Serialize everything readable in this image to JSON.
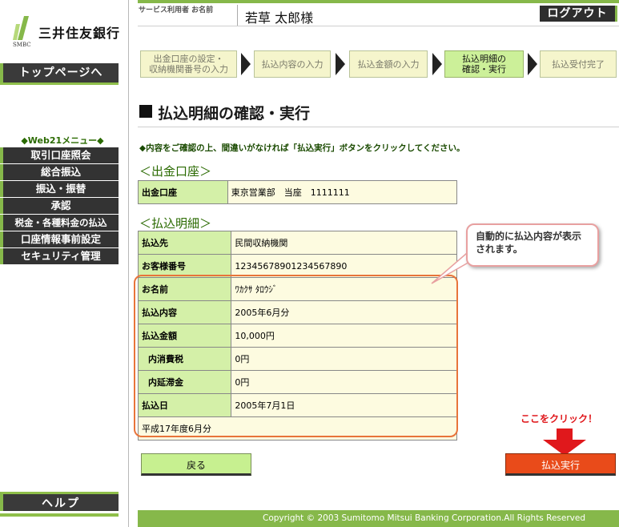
{
  "brand": {
    "name": "三井住友銀行",
    "sub": "SMBC",
    "accent": "#86b84a"
  },
  "sidebar": {
    "top_button": "トップページへ",
    "menu_title": "◆Web21メニュー◆",
    "items": [
      {
        "label": "取引口座照会"
      },
      {
        "label": "総合振込"
      },
      {
        "label": "振込・振替"
      },
      {
        "label": "承認"
      },
      {
        "label": "税金・各種料金の払込"
      },
      {
        "label": "口座情報事前設定"
      },
      {
        "label": "セキュリティ管理"
      }
    ],
    "help": "ヘルプ"
  },
  "header": {
    "user_label": "サービス利用者 お名前",
    "user_name": "若草 太郎様",
    "logout": "ログアウト"
  },
  "steps": [
    {
      "label": "出金口座の設定・\n収納機関番号の入力",
      "current": false
    },
    {
      "label": "払込内容の入力",
      "current": false
    },
    {
      "label": "払込金額の入力",
      "current": false
    },
    {
      "label": "払込明細の\n確認・実行",
      "current": true
    },
    {
      "label": "払込受付完了",
      "current": false
    }
  ],
  "page": {
    "title": "払込明細の確認・実行",
    "instruction": "◆内容をご確認の上、間違いがなければ「払込実行」ボタンをクリックしてください。"
  },
  "account_section": {
    "heading": "＜出金口座＞",
    "rows": [
      {
        "key": "出金口座",
        "value": "東京営業部　当座　1111111"
      }
    ]
  },
  "detail_section": {
    "heading": "＜払込明細＞",
    "rows": [
      {
        "key": "払込先",
        "value": "民間収納機関"
      },
      {
        "key": "お客様番号",
        "value": "12345678901234567890"
      },
      {
        "key": "お名前",
        "value": "ﾜｶｸｻ ﾀﾛｳｼﾞ"
      },
      {
        "key": "払込内容",
        "value": "2005年6月分"
      },
      {
        "key": "払込金額",
        "value": "10,000円"
      },
      {
        "key": "内消費税",
        "value": "0円"
      },
      {
        "key": "内延滞金",
        "value": "0円"
      },
      {
        "key": "払込日",
        "value": "2005年7月1日"
      }
    ],
    "note": "平成17年度6月分"
  },
  "callout": {
    "text": "自動的に払込内容が表示されます。"
  },
  "click_hint": "ここをクリック！",
  "buttons": {
    "back": "戻る",
    "execute": "払込実行"
  },
  "footer": {
    "copyright": "Copyright © 2003 Sumitomo Mitsui Banking Corporation.All Rights Reserved"
  }
}
